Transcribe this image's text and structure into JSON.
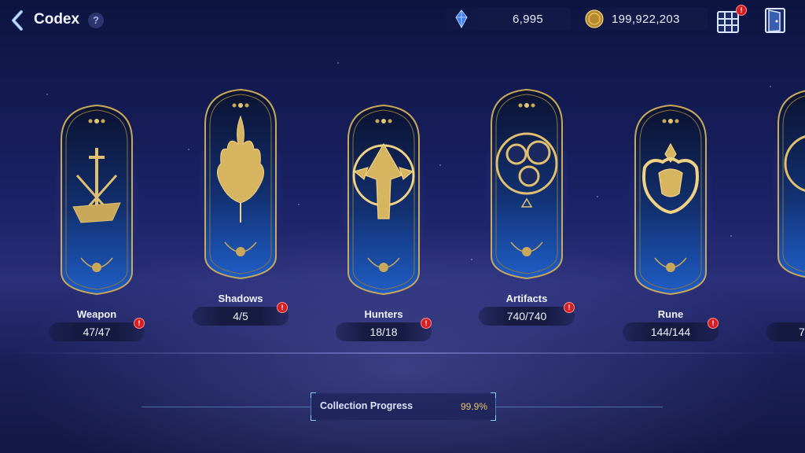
{
  "header": {
    "title": "Codex",
    "help_label": "?",
    "gems": "6,995",
    "gold": "199,922,203"
  },
  "categories": [
    {
      "label": "Weapon",
      "count": "47/47",
      "icon": "crossed-swords-icon"
    },
    {
      "label": "Shadows",
      "count": "4/5",
      "icon": "flame-flower-icon"
    },
    {
      "label": "Hunters",
      "count": "18/18",
      "icon": "hooded-hunter-icon"
    },
    {
      "label": "Artifacts",
      "count": "740/740",
      "icon": "artifact-medallions-icon"
    },
    {
      "label": "Rune",
      "count": "144/144",
      "icon": "rune-crest-icon"
    },
    {
      "label": "",
      "count": "7",
      "icon": "partial-card-icon"
    }
  ],
  "progress": {
    "label": "Collection Progress",
    "value": "99.9%"
  },
  "colors": {
    "gold": "#c9a85a",
    "badge_red": "#d41f24",
    "card_blue": "#1c3f8f"
  }
}
